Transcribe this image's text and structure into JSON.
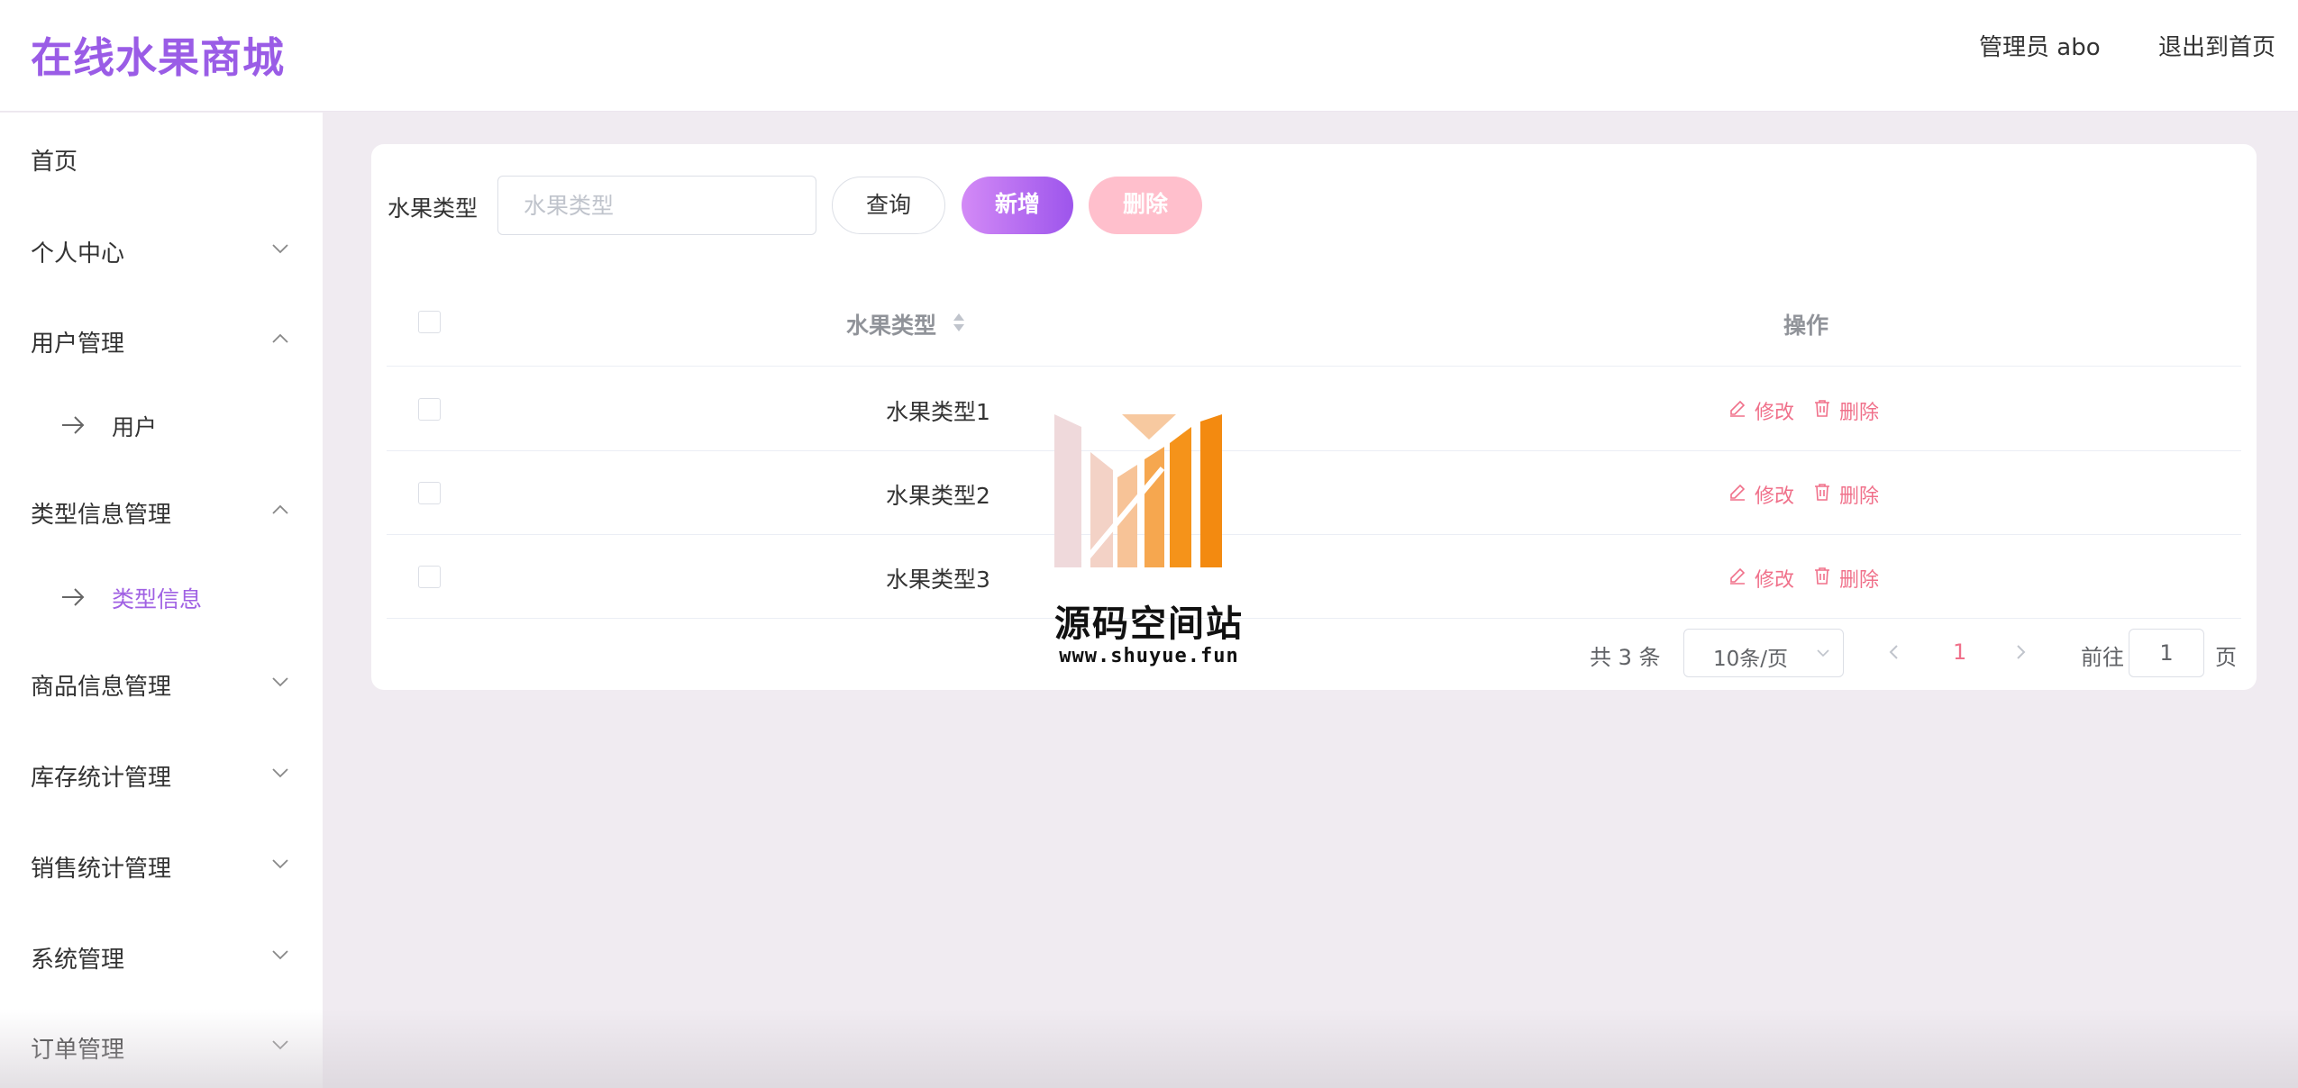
{
  "header": {
    "brand": "在线水果商城",
    "admin_label": "管理员 abo",
    "exit_label": "退出到首页"
  },
  "sidebar": {
    "items": [
      {
        "label": "首页",
        "chevron": "none"
      },
      {
        "label": "个人中心",
        "chevron": "down"
      },
      {
        "label": "用户管理",
        "chevron": "up"
      },
      {
        "label": "用户",
        "sub": true
      },
      {
        "label": "类型信息管理",
        "chevron": "up"
      },
      {
        "label": "类型信息",
        "sub": true,
        "active": true
      },
      {
        "label": "商品信息管理",
        "chevron": "down"
      },
      {
        "label": "库存统计管理",
        "chevron": "down"
      },
      {
        "label": "销售统计管理",
        "chevron": "down"
      },
      {
        "label": "系统管理",
        "chevron": "down"
      },
      {
        "label": "订单管理",
        "chevron": "down"
      }
    ]
  },
  "search": {
    "label": "水果类型",
    "placeholder": "水果类型",
    "value": "",
    "query_label": "查询",
    "add_label": "新增",
    "delete_label": "删除"
  },
  "table": {
    "columns": [
      "水果类型",
      "操作"
    ],
    "rows": [
      {
        "type": "水果类型1",
        "edit": "修改",
        "delete": "删除"
      },
      {
        "type": "水果类型2",
        "edit": "修改",
        "delete": "删除"
      },
      {
        "type": "水果类型3",
        "edit": "修改",
        "delete": "删除"
      }
    ]
  },
  "pagination": {
    "total_text": "共 3 条",
    "page_size": "10条/页",
    "current_page": "1",
    "goto_label": "前往",
    "goto_value": "1",
    "goto_suffix": "页"
  },
  "watermark": {
    "title": "源码空间站",
    "url": "www.shuyue.fun"
  },
  "colors": {
    "brand": "#9a5ce6",
    "accent_gradient_start": "#d38af6",
    "accent_gradient_end": "#9d55ec",
    "danger_light": "#ffbfcc",
    "action_link": "#f0708a",
    "background": "#f0ebf1"
  }
}
